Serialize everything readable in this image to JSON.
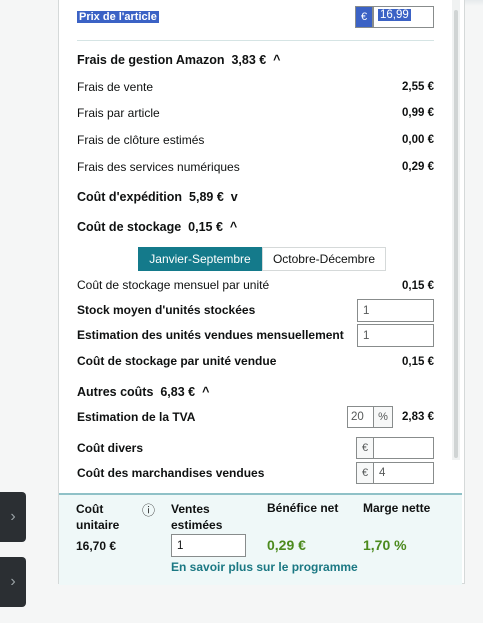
{
  "top": {
    "price_label": "Prix de l'article",
    "currency": "€",
    "price_value": "16,99"
  },
  "amazon_fees": {
    "title": "Frais de gestion Amazon",
    "total": "3,83 €",
    "rows": [
      {
        "label": "Frais de vente",
        "value": "2,55 €"
      },
      {
        "label": "Frais par article",
        "value": "0,99 €"
      },
      {
        "label": "Frais de clôture estimés",
        "value": "0,00 €"
      },
      {
        "label": "Frais des services numériques",
        "value": "0,29 €"
      }
    ]
  },
  "shipping": {
    "title": "Coût d'expédition",
    "total": "5,89 €"
  },
  "storage": {
    "title": "Coût de stockage",
    "total": "0,15 €",
    "tabs": [
      "Janvier-Septembre",
      "Octobre-Décembre"
    ],
    "monthly_label": "Coût de stockage mensuel par unité",
    "monthly_value": "0,15 €",
    "avg_stock_label": "Stock moyen d'unités stockées",
    "avg_stock_value": "1",
    "est_sold_label": "Estimation des unités vendues mensuellement",
    "est_sold_value": "1",
    "per_unit_label": "Coût de stockage par unité vendue",
    "per_unit_value": "0,15 €"
  },
  "other": {
    "title": "Autres coûts",
    "total": "6,83 €",
    "vat_label": "Estimation de la TVA",
    "vat_rate": "20",
    "vat_pct": "%",
    "vat_value": "2,83 €",
    "misc_label": "Coût divers",
    "misc_value": "",
    "cogs_label": "Coût des marchandises vendues",
    "cogs_value": "4",
    "currency": "€"
  },
  "footer": {
    "unit_cost_label_1": "Coût",
    "unit_cost_label_2": "unitaire",
    "unit_cost_value": "16,70 €",
    "info_icon": "ⓘ",
    "sales_label_1": "Ventes",
    "sales_label_2": "estimées",
    "sales_value": "1",
    "net_profit_label": "Bénéfice net",
    "net_profit_value": "0,29 €",
    "net_margin_label": "Marge nette",
    "net_margin_value": "1,70 %",
    "learn_more": "En savoir plus sur le programme"
  },
  "icons": {
    "chevron_up": "^",
    "chevron_down": "v",
    "side_arrow": "›"
  }
}
